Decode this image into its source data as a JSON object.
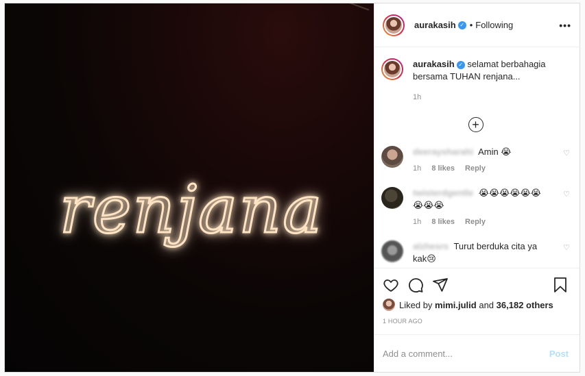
{
  "post": {
    "image_text": "renjana",
    "author": "aurakasih",
    "verified_mark": "✓",
    "follow_state": "Following",
    "separator": "•",
    "more_label": "•••"
  },
  "caption": {
    "username": "aurakasih",
    "text": "selamat berbahagia bersama TUHAN renjana...",
    "time": "1h"
  },
  "load_more_symbol": "+",
  "comments": [
    {
      "username": "deeraysharahi",
      "text": "Amin 😭",
      "time": "1h",
      "likes": "8 likes",
      "reply": "Reply",
      "avatar_color": "#6b5a50"
    },
    {
      "username": "twisterdgentle",
      "text": "😭😭😭😭😭😭😭😭😭",
      "time": "1h",
      "likes": "8 likes",
      "reply": "Reply",
      "avatar_color": "#3a3428"
    },
    {
      "username": "alzhesrs",
      "text": "Turut berduka cita ya kak😢",
      "time": "",
      "likes": "",
      "reply": "",
      "avatar_color": "#6e6e6e"
    }
  ],
  "likes": {
    "prefix": "Liked by",
    "user": "mimi.julid",
    "middle": "and",
    "others": "36,182 others"
  },
  "timestamp": "1 HOUR AGO",
  "add_comment": {
    "placeholder": "Add a comment...",
    "post_label": "Post"
  },
  "icons": [
    "heart-icon",
    "comment-icon",
    "share-icon",
    "bookmark-icon",
    "small-heart-icon",
    "plus-circle-icon"
  ],
  "colors": {
    "verified": "#3897f0",
    "neon": "#ffe4c4",
    "post_disabled": "#b2dffc"
  }
}
